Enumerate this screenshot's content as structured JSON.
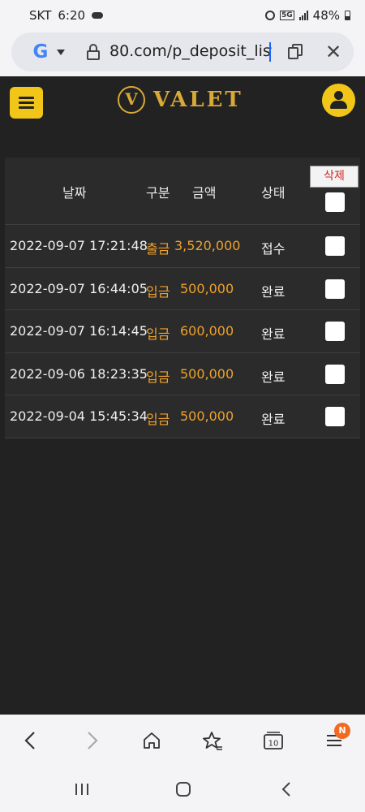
{
  "status_bar": {
    "carrier": "SKT",
    "time": "6:20",
    "network": "5G",
    "battery": "48%"
  },
  "browser": {
    "url": "80.com/p_deposit_list",
    "tabs_count": "10",
    "menu_badge": "N"
  },
  "site": {
    "logo_mark": "V",
    "logo_text": "VALET",
    "accent_color": "#f2c619",
    "logo_color": "#d9a937",
    "amount_color": "#efa12b"
  },
  "table": {
    "headers": {
      "date": "날짜",
      "type": "구분",
      "amount": "금액",
      "status": "상태",
      "delete": "삭제"
    },
    "rows": [
      {
        "date": "2022-09-07 17:21:48",
        "type": "출금",
        "amount": "3,520,000",
        "status": "접수"
      },
      {
        "date": "2022-09-07 16:44:05",
        "type": "입금",
        "amount": "500,000",
        "status": "완료"
      },
      {
        "date": "2022-09-07 16:14:45",
        "type": "입금",
        "amount": "600,000",
        "status": "완료"
      },
      {
        "date": "2022-09-06 18:23:35",
        "type": "입금",
        "amount": "500,000",
        "status": "완료"
      },
      {
        "date": "2022-09-04 15:45:34",
        "type": "입금",
        "amount": "500,000",
        "status": "완료"
      }
    ]
  }
}
